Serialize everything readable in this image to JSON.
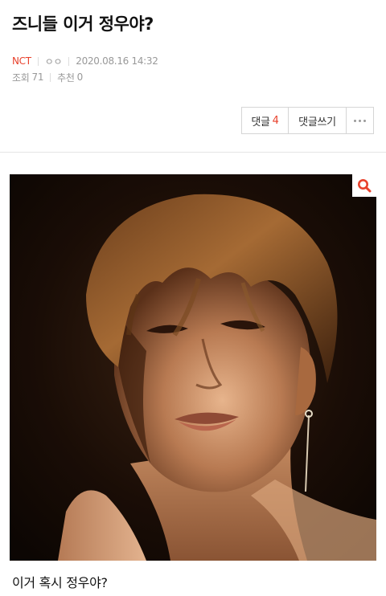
{
  "post": {
    "title": "즈니들 이거 정우야?",
    "category": "NCT",
    "author": "ㅇㅇ",
    "datetime": "2020.08.16 14:32",
    "views_label": "조회",
    "views": "71",
    "recommend_label": "추천",
    "recommend": "0",
    "caption": "이거 혹시 정우야?"
  },
  "actions": {
    "comments_label": "댓글",
    "comments_count": "4",
    "write_comment_label": "댓글쓰기"
  },
  "colors": {
    "accent": "#e8412c",
    "meta_gray": "#999999",
    "border": "#d5d5d5"
  },
  "icons": {
    "zoom": "search-icon",
    "more": "more-horizontal-icon"
  }
}
